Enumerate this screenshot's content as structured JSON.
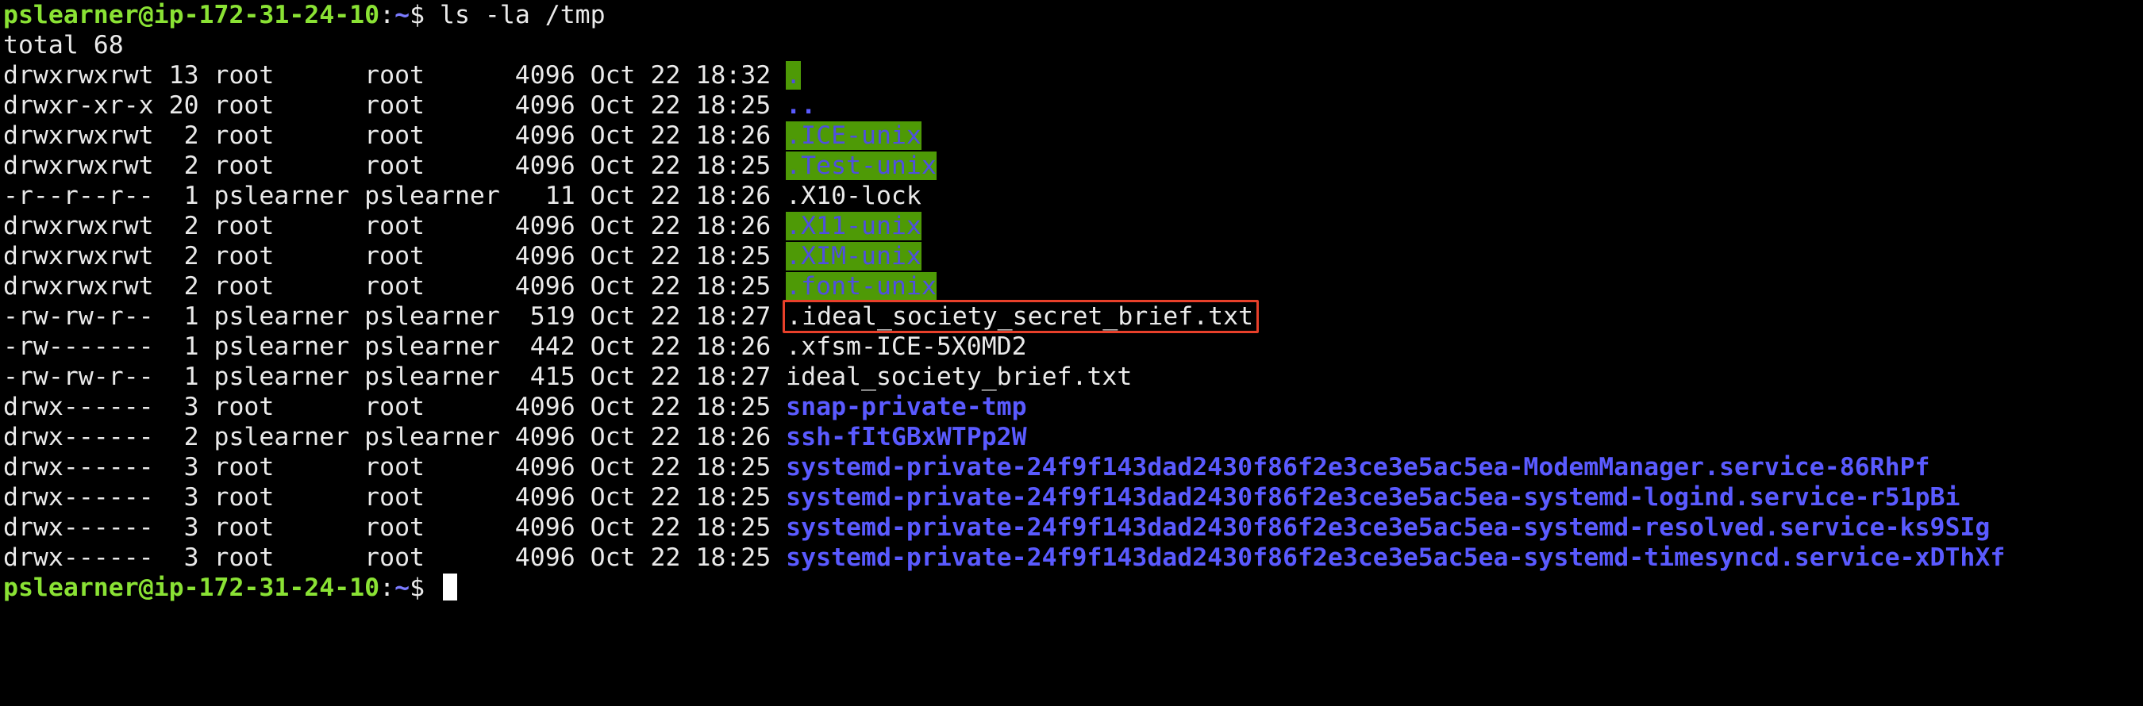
{
  "prompt": {
    "user_host": "pslearner@ip-172-31-24-10",
    "path": "~",
    "symbol": "$"
  },
  "command": "ls -la /tmp",
  "total_line": "total 68",
  "listing": [
    {
      "meta": "drwxrwxrwt 13 root      root      4096 Oct 22 18:32 ",
      "name": ".",
      "style": "dir-hl"
    },
    {
      "meta": "drwxr-xr-x 20 root      root      4096 Oct 22 18:25 ",
      "name": "..",
      "style": "dir"
    },
    {
      "meta": "drwxrwxrwt  2 root      root      4096 Oct 22 18:26 ",
      "name": ".ICE-unix",
      "style": "dir-hl"
    },
    {
      "meta": "drwxrwxrwt  2 root      root      4096 Oct 22 18:25 ",
      "name": ".Test-unix",
      "style": "dir-hl"
    },
    {
      "meta": "-r--r--r--  1 pslearner pslearner   11 Oct 22 18:26 ",
      "name": ".X10-lock",
      "style": "file"
    },
    {
      "meta": "drwxrwxrwt  2 root      root      4096 Oct 22 18:26 ",
      "name": ".X11-unix",
      "style": "dir-hl"
    },
    {
      "meta": "drwxrwxrwt  2 root      root      4096 Oct 22 18:25 ",
      "name": ".XIM-unix",
      "style": "dir-hl"
    },
    {
      "meta": "drwxrwxrwt  2 root      root      4096 Oct 22 18:25 ",
      "name": ".font-unix",
      "style": "dir-hl"
    },
    {
      "meta": "-rw-rw-r--  1 pslearner pslearner  519 Oct 22 18:27 ",
      "name": ".ideal_society_secret_brief.txt",
      "style": "file-boxed"
    },
    {
      "meta": "-rw-------  1 pslearner pslearner  442 Oct 22 18:26 ",
      "name": ".xfsm-ICE-5X0MD2",
      "style": "file"
    },
    {
      "meta": "-rw-rw-r--  1 pslearner pslearner  415 Oct 22 18:27 ",
      "name": "ideal_society_brief.txt",
      "style": "file"
    },
    {
      "meta": "drwx------  3 root      root      4096 Oct 22 18:25 ",
      "name": "snap-private-tmp",
      "style": "dir"
    },
    {
      "meta": "drwx------  2 pslearner pslearner 4096 Oct 22 18:26 ",
      "name": "ssh-fItGBxWTPp2W",
      "style": "dir"
    },
    {
      "meta": "drwx------  3 root      root      4096 Oct 22 18:25 ",
      "name": "systemd-private-24f9f143dad2430f86f2e3ce3e5ac5ea-ModemManager.service-86RhPf",
      "style": "dir"
    },
    {
      "meta": "drwx------  3 root      root      4096 Oct 22 18:25 ",
      "name": "systemd-private-24f9f143dad2430f86f2e3ce3e5ac5ea-systemd-logind.service-r51pBi",
      "style": "dir"
    },
    {
      "meta": "drwx------  3 root      root      4096 Oct 22 18:25 ",
      "name": "systemd-private-24f9f143dad2430f86f2e3ce3e5ac5ea-systemd-resolved.service-ks9SIg",
      "style": "dir"
    },
    {
      "meta": "drwx------  3 root      root      4096 Oct 22 18:25 ",
      "name": "systemd-private-24f9f143dad2430f86f2e3ce3e5ac5ea-systemd-timesyncd.service-xDThXf",
      "style": "dir"
    }
  ],
  "colors": {
    "background": "#000000",
    "prompt_user": "#8ae234",
    "prompt_path": "#7b7bff",
    "dir": "#5a5aff",
    "dir_highlight_bg": "#4e9a06",
    "annotation_box": "#e8402a"
  }
}
